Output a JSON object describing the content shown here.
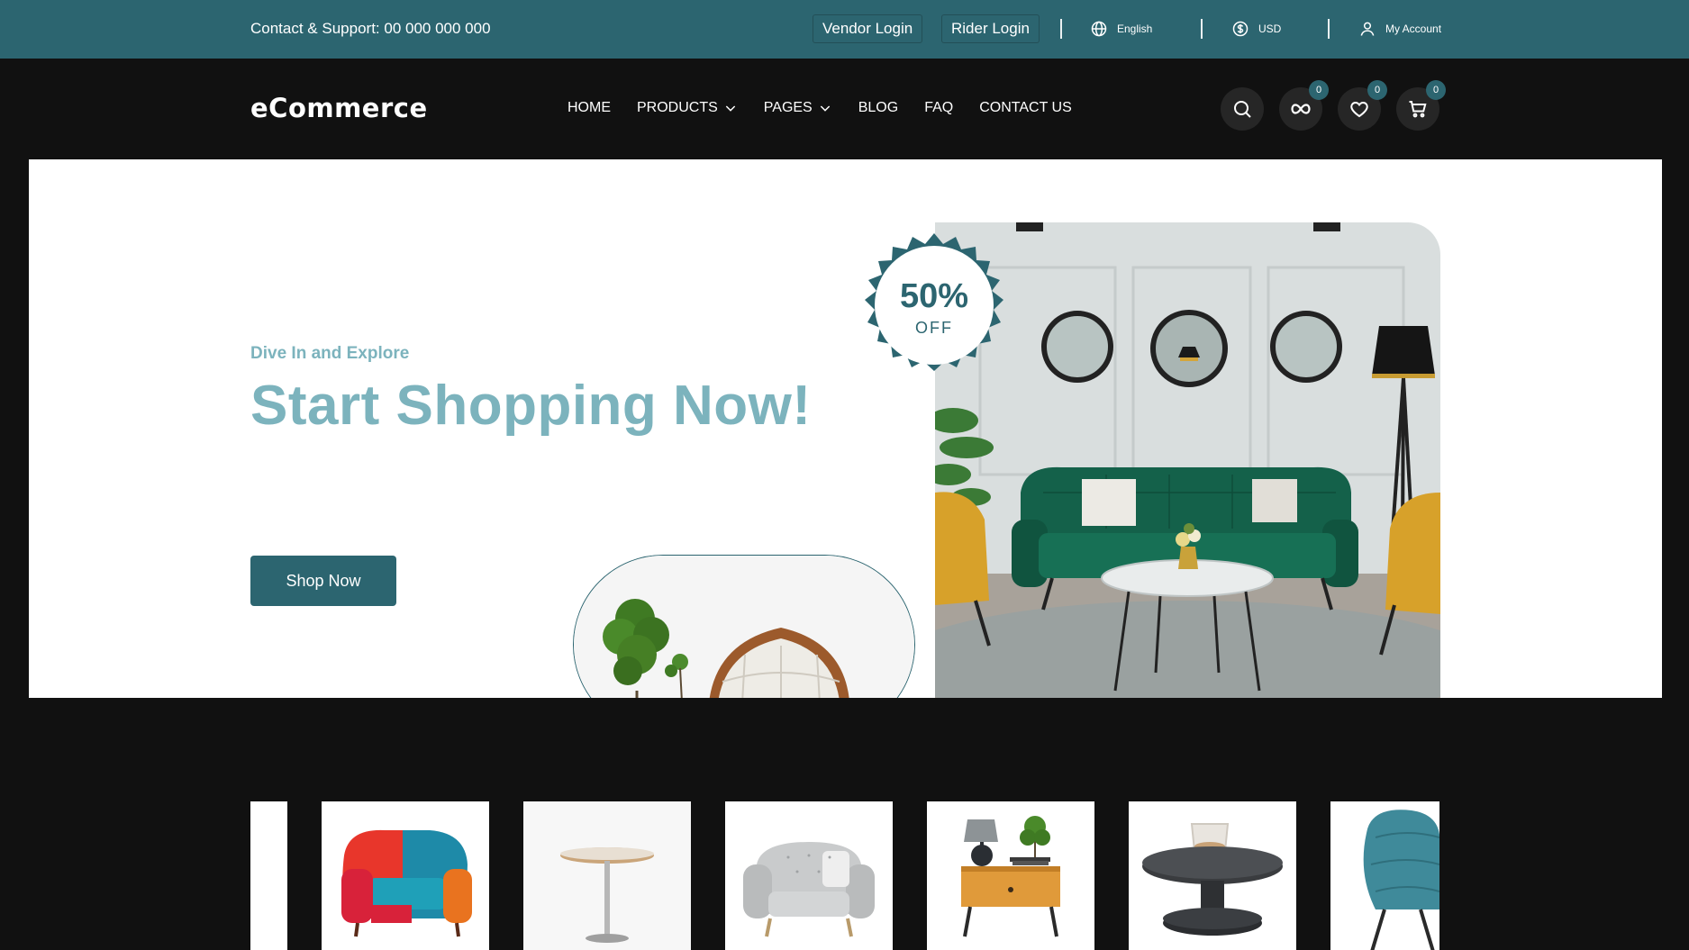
{
  "topbar": {
    "contact": "Contact & Support: 00 000 000 000",
    "vendor_login": "Vendor Login",
    "rider_login": "Rider Login",
    "language": "English",
    "currency": "USD",
    "account": "My Account"
  },
  "nav": {
    "logo": "eCommerce",
    "items": [
      {
        "label": "HOME",
        "dropdown": false
      },
      {
        "label": "PRODUCTS",
        "dropdown": true
      },
      {
        "label": "PAGES",
        "dropdown": true
      },
      {
        "label": "BLOG",
        "dropdown": false
      },
      {
        "label": "FAQ",
        "dropdown": false
      },
      {
        "label": "CONTACT US",
        "dropdown": false
      }
    ],
    "icons": [
      {
        "name": "search-icon",
        "badge": null
      },
      {
        "name": "compare-icon",
        "badge": "0"
      },
      {
        "name": "heart-icon",
        "badge": "0"
      },
      {
        "name": "cart-icon",
        "badge": "0"
      }
    ]
  },
  "hero": {
    "subtitle": "Dive In and Explore",
    "title": "Start Shopping Now!",
    "button": "Shop Now",
    "discount_value": "50%",
    "discount_label": "OFF"
  },
  "products": [
    {
      "name": "partial-product-image"
    },
    {
      "name": "armchair-product-image"
    },
    {
      "name": "side-table-product-image"
    },
    {
      "name": "grey-armchair-product-image"
    },
    {
      "name": "nightstand-product-image"
    },
    {
      "name": "coffee-table-product-image"
    },
    {
      "name": "teal-chair-product-image"
    }
  ],
  "colors": {
    "brand": "#2c6570",
    "hero_text": "#7cb3bd",
    "background": "#111111"
  }
}
